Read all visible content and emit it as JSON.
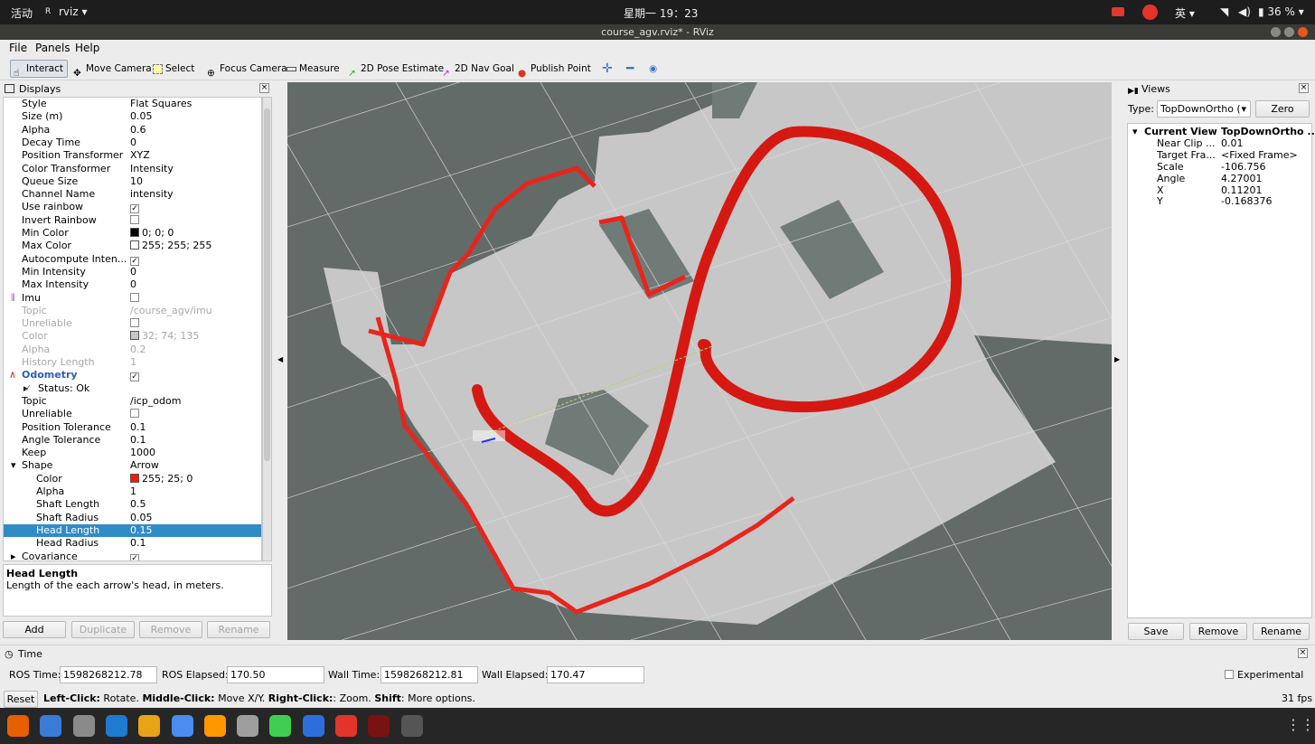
{
  "topbar": {
    "activities": "活动",
    "app_name": "rviz",
    "clock": "星期一 19：23",
    "input_method": "英",
    "battery": "36 %"
  },
  "window": {
    "title": "course_agv.rviz* - RViz"
  },
  "menu": {
    "file": "File",
    "panels": "Panels",
    "help": "Help"
  },
  "toolbar": {
    "interact": "Interact",
    "move_camera": "Move Camera",
    "select": "Select",
    "focus_camera": "Focus Camera",
    "measure": "Measure",
    "pose_estimate": "2D Pose Estimate",
    "nav_goal": "2D Nav Goal",
    "publish_point": "Publish Point"
  },
  "displays": {
    "title": "Displays",
    "rows": [
      {
        "key": "Style",
        "value": "Flat Squares"
      },
      {
        "key": "Size (m)",
        "value": "0.05"
      },
      {
        "key": "Alpha",
        "value": "0.6"
      },
      {
        "key": "Decay Time",
        "value": "0"
      },
      {
        "key": "Position Transformer",
        "value": "XYZ"
      },
      {
        "key": "Color Transformer",
        "value": "Intensity"
      },
      {
        "key": "Queue Size",
        "value": "10"
      },
      {
        "key": "Channel Name",
        "value": "intensity"
      },
      {
        "key": "Use rainbow",
        "value": "✓"
      },
      {
        "key": "Invert Rainbow",
        "value": ""
      },
      {
        "key": "Min Color",
        "value": "0; 0; 0"
      },
      {
        "key": "Max Color",
        "value": "255; 255; 255"
      },
      {
        "key": "Autocompute Inten...",
        "value": "✓"
      },
      {
        "key": "Min Intensity",
        "value": "0"
      },
      {
        "key": "Max Intensity",
        "value": "0"
      },
      {
        "key": "Imu",
        "value": ""
      },
      {
        "key": "Topic",
        "value": "/course_agv/imu"
      },
      {
        "key": "Unreliable",
        "value": ""
      },
      {
        "key": "Color",
        "value": "32; 74; 135"
      },
      {
        "key": "Alpha",
        "value": "0.2"
      },
      {
        "key": "History Length",
        "value": "1"
      },
      {
        "key": "Odometry",
        "value": "✓"
      },
      {
        "key": "Status: Ok",
        "value": ""
      },
      {
        "key": "Topic",
        "value": "/icp_odom"
      },
      {
        "key": "Unreliable",
        "value": ""
      },
      {
        "key": "Position Tolerance",
        "value": "0.1"
      },
      {
        "key": "Angle Tolerance",
        "value": "0.1"
      },
      {
        "key": "Keep",
        "value": "1000"
      },
      {
        "key": "Shape",
        "value": "Arrow"
      },
      {
        "key": "Color",
        "value": "255; 25; 0"
      },
      {
        "key": "Alpha",
        "value": "1"
      },
      {
        "key": "Shaft Length",
        "value": "0.5"
      },
      {
        "key": "Shaft Radius",
        "value": "0.05"
      },
      {
        "key": "Head Length",
        "value": "0.15"
      },
      {
        "key": "Head Radius",
        "value": "0.1"
      },
      {
        "key": "Covariance",
        "value": "✓"
      }
    ],
    "colors": {
      "min": "#000000",
      "max": "#ffffff",
      "imu": "#c8c8c8",
      "odom": "#ff1900"
    },
    "desc_title": "Head Length",
    "desc_text": "Length of the each arrow's head, in meters.",
    "buttons": {
      "add": "Add",
      "duplicate": "Duplicate",
      "remove": "Remove",
      "rename": "Rename"
    }
  },
  "views": {
    "title": "Views",
    "type_label": "Type:",
    "type_value": "TopDownOrtho (",
    "zero": "Zero",
    "rows": [
      {
        "key": "Current View",
        "value": "TopDownOrtho ..."
      },
      {
        "key": "Near Clip ...",
        "value": "0.01"
      },
      {
        "key": "Target Fra...",
        "value": "<Fixed Frame>"
      },
      {
        "key": "Scale",
        "value": "-106.756"
      },
      {
        "key": "Angle",
        "value": "4.27001"
      },
      {
        "key": "X",
        "value": "0.11201"
      },
      {
        "key": "Y",
        "value": "-0.168376"
      }
    ],
    "buttons": {
      "save": "Save",
      "remove": "Remove",
      "rename": "Rename"
    }
  },
  "time": {
    "title": "Time",
    "ros_time_label": "ROS Time:",
    "ros_time": "1598268212.78",
    "ros_elapsed_label": "ROS Elapsed:",
    "ros_elapsed": "170.50",
    "wall_time_label": "Wall Time:",
    "wall_time": "1598268212.81",
    "wall_elapsed_label": "Wall Elapsed:",
    "wall_elapsed": "170.47",
    "experimental": "Experimental"
  },
  "status": {
    "reset": "Reset",
    "b1": "Left-Click:",
    "t1": " Rotate. ",
    "b2": "Middle-Click:",
    "t2": " Move X/Y. ",
    "b3": "Right-Click:",
    "t3": ": Zoom. ",
    "b4": "Shift",
    "t4": ": More options.",
    "fps": "31 fps"
  },
  "dock": {
    "items": [
      "firefox-icon",
      "thunderbird-icon",
      "files-icon",
      "vscode-icon",
      "chrome-icon",
      "baidunetdisk-icon",
      "sublime-icon",
      "camera-icon",
      "qt-icon",
      "wps-icon",
      "netease-music-icon",
      "terminal-icon",
      "rviz-icon"
    ]
  }
}
